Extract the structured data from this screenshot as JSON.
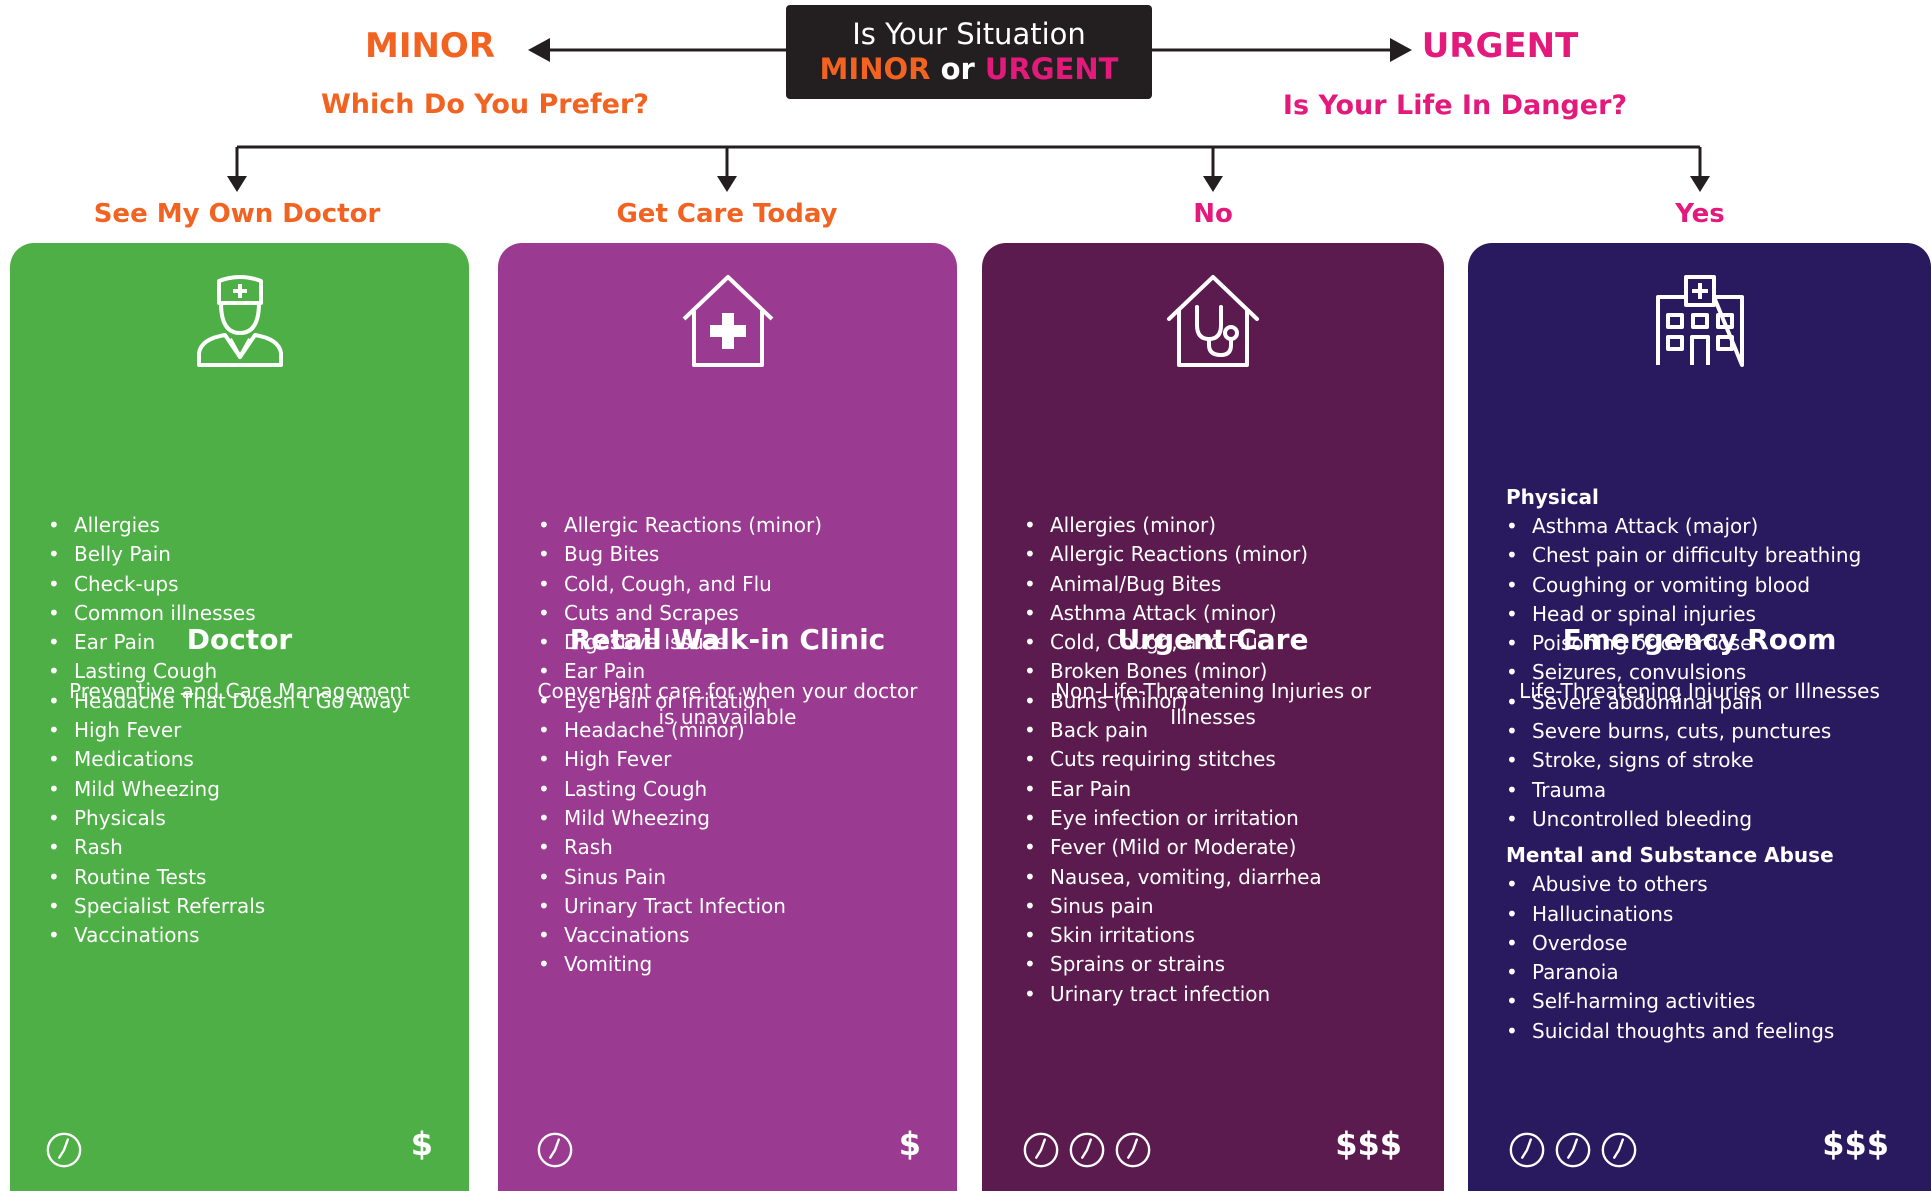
{
  "question": {
    "line1": "Is Your Situation",
    "minor_word": "MINOR",
    "or_word": "or",
    "urgent_word": "URGENT"
  },
  "minor": {
    "label": "MINOR",
    "prompt": "Which Do  You Prefer?"
  },
  "urgent": {
    "label": "URGENT",
    "prompt": "Is Your Life In Danger?"
  },
  "branches": [
    "See My Own Doctor",
    "Get Care Today",
    "No",
    "Yes"
  ],
  "colors": {
    "orange": "#f26322",
    "magenta": "#e3197c",
    "dark": "#231f20",
    "doctor": "#4daf45",
    "retail": "#9a3a91",
    "urgent_care": "#5b1b4f",
    "er": "#29195e"
  },
  "cards": [
    {
      "title": "Doctor",
      "description": "Preventive and Care Management",
      "icon": "doctor-icon",
      "items": [
        "Allergies",
        "Belly Pain",
        "Check-ups",
        "Common illnesses",
        "Ear Pain",
        "Lasting Cough",
        "Headache That Doesn’t Go Away",
        "High Fever",
        "Medications",
        "Mild Wheezing",
        "Physicals",
        "Rash",
        "Routine Tests",
        "Specialist Referrals",
        "Vaccinations"
      ],
      "time_icons": 1,
      "cost": "$"
    },
    {
      "title": "Retail Walk-in Clinic",
      "description": "Convenient care for when your doctor is unavailable",
      "icon": "house-plus-icon",
      "items": [
        "Allergic Reactions (minor)",
        "Bug Bites",
        "Cold, Cough, and Flu",
        "Cuts and Scrapes",
        "Digestive Issues",
        "Ear Pain",
        "Eye Pain or Irritation",
        "Headache (minor)",
        "High Fever",
        "Lasting Cough",
        "Mild Wheezing",
        "Rash",
        "Sinus Pain",
        "Urinary Tract Infection",
        "Vaccinations",
        "Vomiting"
      ],
      "time_icons": 1,
      "cost": "$"
    },
    {
      "title": "Urgent Care",
      "description": "Non-Life-Threatening Injuries or Illnesses",
      "icon": "house-stethoscope-icon",
      "items": [
        "Allergies (minor)",
        "Allergic Reactions (minor)",
        "Animal/Bug Bites",
        "Asthma Attack (minor)",
        "Cold, Cough, and Flu",
        "Broken Bones (minor)",
        "Burns (minor)",
        "Back pain",
        "Cuts requiring stitches",
        "Ear Pain",
        "Eye infection or irritation",
        "Fever (Mild or Moderate)",
        "Nausea, vomiting, diarrhea",
        "Sinus pain",
        "Skin irritations",
        "Sprains or strains",
        "Urinary tract infection"
      ],
      "time_icons": 3,
      "cost": "$$$"
    },
    {
      "title": "Emergency Room",
      "description": "Life-Threatening Injuries or Illnesses",
      "icon": "hospital-icon",
      "groups": [
        {
          "title": "Physical",
          "items": [
            "Asthma Attack (major)",
            "Chest pain or difficulty breathing",
            "Coughing or vomiting blood",
            "Head or spinal injuries",
            "Poisoning or overdose",
            "Seizures, convulsions",
            "Severe abdominal pain",
            "Severe burns, cuts, punctures",
            "Stroke, signs of stroke",
            "Trauma",
            "Uncontrolled bleeding"
          ]
        },
        {
          "title": "Mental and Substance Abuse",
          "items": [
            "Abusive to others",
            "Hallucinations",
            "Overdose",
            "Paranoia",
            "Self-harming activities",
            "Suicidal thoughts and feelings"
          ]
        }
      ],
      "time_icons": 3,
      "cost": "$$$"
    }
  ]
}
